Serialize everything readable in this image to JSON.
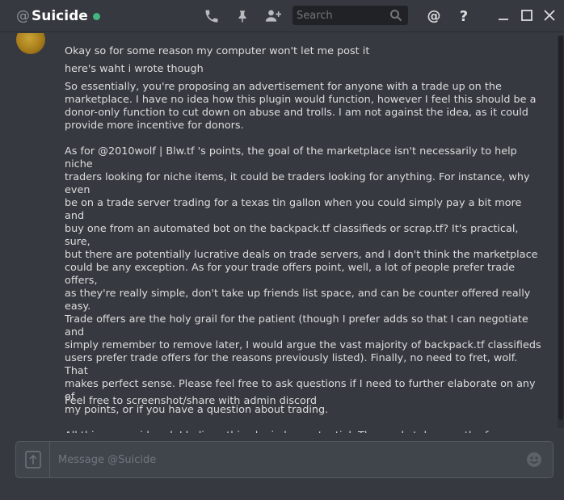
{
  "header": {
    "at_sign": "@",
    "username": "Suicide",
    "search_placeholder": "Search",
    "help_glyph": "?",
    "mention_glyph": "@",
    "icons": [
      "phone-icon",
      "pin-icon",
      "add-friend-icon",
      "search-icon",
      "mention-icon",
      "help-icon",
      "minimize-icon",
      "maximize-icon",
      "close-icon"
    ]
  },
  "messages": [
    "Okay so for some reason my computer won't let me post it",
    "here's waht i wrote though",
    "So essentially, you're proposing an advertisement for anyone with a trade up on the\nmarketplace. I have no idea how this plugin would function, however I feel this should be a\ndonor-only function to cut down on abuse and trolls. I am not against the idea, as it could\nprovide more incentive for donors.\n\nAs for @2010wolf | Blw.tf 's points, the goal of the marketplace isn't necessarily to help niche\ntraders looking for niche items, it could be traders looking for anything. For instance, why even\nbe on a trade server trading for a texas tin gallon when you could simply pay a bit more and\nbuy one from an automated bot on the backpack.tf classifieds or scrap.tf? It's practical, sure,\nbut there are potentially lucrative deals on trade servers, and I don't think the marketplace\ncould be any exception. As for your trade offers point, well, a lot of people prefer trade offers,\nas they're really simple, don't take up friends list space, and can be counter offered really easy.\nTrade offers are the holy grail for the patient (though I prefer adds so that I can negotiate and\nsimply remember to remove later, I would argue the vast majority of backpack.tf classifieds\nusers prefer trade offers for the reasons previously listed). Finally, no need to fret, wolf. That\nmakes perfect sense. Please feel free to ask questions if I need to further elaborate on any of\nmy points, or if you have a question about trading.\n\nAll things considered, I believe this plugin has potential. The marketplace on the forums\ndoesn't get a whole lot of love, and this could kick it into another gear. However, I'm aware\nthat Benedevil is incredibly busy at the moment, and creating such a plugin would be time-\nconsuming. At the end of the day, I believe it'd be worth it, but the advertisements would have\nto be put up in moderation, and the whole concept would require a closer eye on the\nmarketplace (for trolls and such).",
    "Feel free to screenshot/share with admin discord"
  ],
  "composer": {
    "placeholder": "Message @Suicide",
    "value": ""
  },
  "colors": {
    "background": "#36393f",
    "status_online": "#43b581",
    "text": "#dcddde",
    "muted": "#72767d"
  }
}
